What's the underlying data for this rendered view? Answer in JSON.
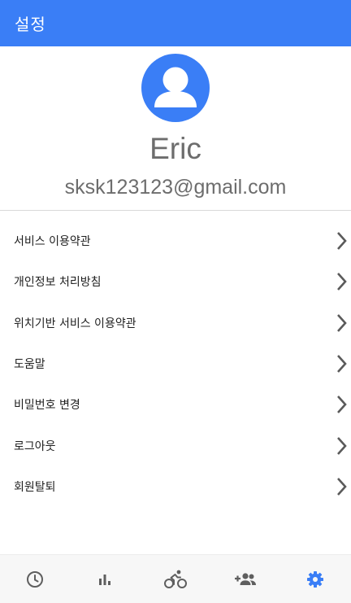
{
  "app_bar": {
    "title": "설정",
    "color": "#3a7ef6"
  },
  "profile": {
    "avatar_icon": "account-circle-icon",
    "name": "Eric",
    "email": "sksk123123@gmail.com"
  },
  "menu": {
    "items": [
      {
        "label": "서비스 이용약관",
        "icon": "chevron-right-icon"
      },
      {
        "label": "개인정보 처리방침",
        "icon": "chevron-right-icon"
      },
      {
        "label": "위치기반 서비스 이용약관",
        "icon": "chevron-right-icon"
      },
      {
        "label": "도움말",
        "icon": "chevron-right-icon"
      },
      {
        "label": "비밀번호 변경",
        "icon": "chevron-right-icon"
      },
      {
        "label": "로그아웃",
        "icon": "chevron-right-icon"
      },
      {
        "label": "회원탈퇴",
        "icon": "chevron-right-icon"
      }
    ]
  },
  "bottom_nav": {
    "items": [
      {
        "icon": "clock-icon",
        "active": false
      },
      {
        "icon": "bar-chart-icon",
        "active": false
      },
      {
        "icon": "cycling-icon",
        "active": false
      },
      {
        "icon": "add-friend-icon",
        "active": false
      },
      {
        "icon": "settings-gear-icon",
        "active": true
      }
    ],
    "active_color": "#3a7ef6",
    "inactive_color": "#5f5f5f"
  }
}
